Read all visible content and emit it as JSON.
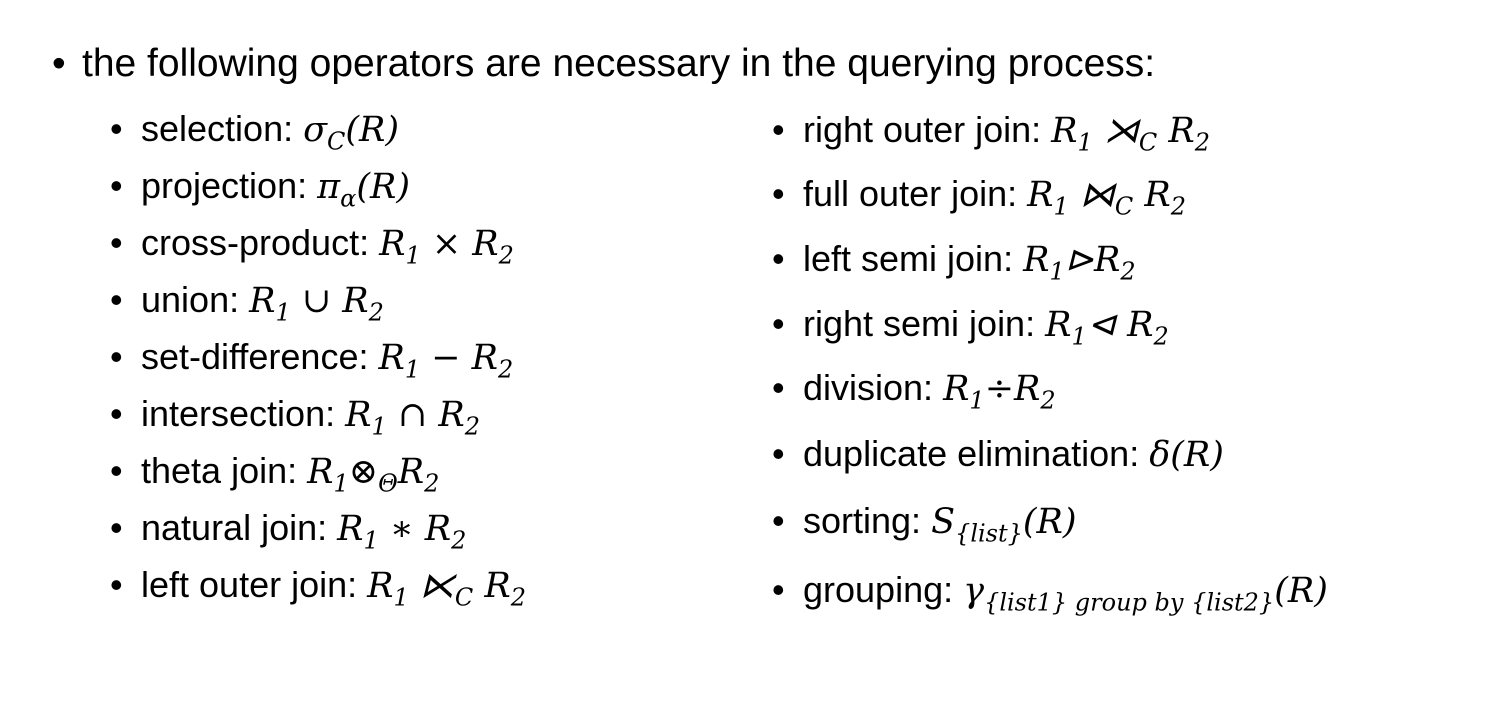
{
  "heading": {
    "bullet": "•",
    "text": "the following operators are necessary in the querying process:"
  },
  "operators_left": [
    {
      "label": "selection: ",
      "math": "σ<sub>C</sub>(R)"
    },
    {
      "label": "projection: ",
      "math": "π<sub>α</sub>(R)"
    },
    {
      "label": "cross-product: ",
      "math": "R<sub>1</sub> × R<sub>2</sub>"
    },
    {
      "label": "union: ",
      "math": "R<sub>1</sub> ∪ R<sub>2</sub>"
    },
    {
      "label": "set-difference: ",
      "math": "R<sub>1</sub> − R<sub>2</sub>"
    },
    {
      "label": "intersection: ",
      "math": "R<sub>1</sub> ∩ R<sub>2</sub>"
    },
    {
      "label": "theta join: ",
      "math": "R<sub>1</sub>⊗<sub>Θ</sub>R<sub>2</sub>"
    },
    {
      "label": "natural join: ",
      "math": "R<sub>1</sub> ∗ R<sub>2</sub>"
    },
    {
      "label": "left outer join: ",
      "math": "R<sub>1</sub> ⋉<sub>C</sub> R<sub>2</sub>"
    }
  ],
  "operators_right": [
    {
      "label": "right outer join: ",
      "math": "R<sub>1</sub> ⋊<sub>C</sub> R<sub>2</sub>"
    },
    {
      "label": "full outer join: ",
      "math": "R<sub>1</sub> ⋈<sub>C</sub> R<sub>2</sub>"
    },
    {
      "label": "left semi join: ",
      "math": "R<sub>1</sub>⊳R<sub>2</sub>"
    },
    {
      "label": "right semi join: ",
      "math": "R<sub>1</sub>⊲ R<sub>2</sub>"
    },
    {
      "label": "division: ",
      "math": "R<sub>1</sub>÷R<sub>2</sub>"
    },
    {
      "label": "duplicate elimination: ",
      "math": "δ(R)"
    },
    {
      "label": "sorting: ",
      "math": "S<sub>{list}</sub>(R)"
    },
    {
      "label": "grouping: ",
      "math": "γ<sub>{list1} group by {list2}</sub>(R)"
    }
  ],
  "bullet": "•"
}
